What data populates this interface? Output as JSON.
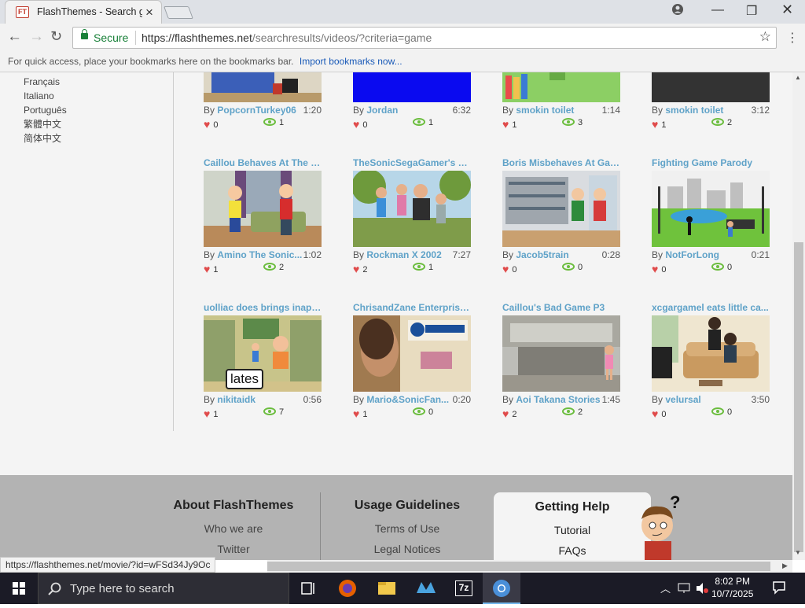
{
  "browser": {
    "tab_title": "FlashThemes - Search ga",
    "favicon_text": "FT",
    "address": {
      "secure_label": "Secure",
      "url_main": "https://flashthemes.net",
      "url_path": "/searchresults/videos/?criteria=game"
    },
    "bookmarks_hint": "For quick access, place your bookmarks here on the bookmarks bar.",
    "import_link": "Import bookmarks now...",
    "status_url": "https://flashthemes.net/movie/?id=wFSd34Jy9Oc"
  },
  "languages": [
    "Français",
    "Italiano",
    "Português",
    "繁體中文",
    "简体中文"
  ],
  "videos": [
    {
      "title": "",
      "author": "PopcornTurkey06",
      "duration": "1:20",
      "likes": "0",
      "views": "1"
    },
    {
      "title": "",
      "author": "Jordan",
      "duration": "6:32",
      "likes": "0",
      "views": "1"
    },
    {
      "title": "",
      "author": "smokin toilet",
      "duration": "1:14",
      "likes": "1",
      "views": "3"
    },
    {
      "title": "",
      "author": "smokin toilet",
      "duration": "3:12",
      "likes": "1",
      "views": "2"
    },
    {
      "title": "Caillou Behaves At The G...",
      "author": "Amino The Sonic...",
      "duration": "1:02",
      "likes": "1",
      "views": "2"
    },
    {
      "title": "TheSonicSegaGamer's m...",
      "author": "Rockman X 2002",
      "duration": "7:27",
      "likes": "2",
      "views": "1"
    },
    {
      "title": "Boris Misbehaves At Gam...",
      "author": "Jacob5train",
      "duration": "0:28",
      "likes": "0",
      "views": "0"
    },
    {
      "title": "Fighting Game Parody",
      "author": "NotForLong",
      "duration": "0:21",
      "likes": "0",
      "views": "0"
    },
    {
      "title": "uolliac does brings inapp...",
      "author": "nikitaidk",
      "duration": "0:56",
      "likes": "1",
      "views": "7"
    },
    {
      "title": "ChrisandZane Enterprise...",
      "author": "Mario&SonicFan...",
      "duration": "0:20",
      "likes": "1",
      "views": "0"
    },
    {
      "title": "Caillou's Bad Game P3",
      "author": "Aoi Takana Stories",
      "duration": "1:45",
      "likes": "2",
      "views": "2"
    },
    {
      "title": "xcgargamel eats little ca...",
      "author": "velursal",
      "duration": "3:50",
      "likes": "0",
      "views": "0"
    }
  ],
  "by_label": "By",
  "thumb_captions": {
    "lates": "lates"
  },
  "footer": {
    "about": {
      "heading": "About FlashThemes",
      "links": [
        "Who we are",
        "Twitter"
      ]
    },
    "usage": {
      "heading": "Usage Guidelines",
      "links": [
        "Terms of Use",
        "Legal Notices"
      ]
    },
    "help": {
      "heading": "Getting Help",
      "links": [
        "Tutorial",
        "FAQs"
      ]
    },
    "question_mark": "?"
  },
  "taskbar": {
    "search_placeholder": "Type here to search",
    "time": "8:02 PM",
    "date": "10/7/2025",
    "app_7z": "7z"
  }
}
